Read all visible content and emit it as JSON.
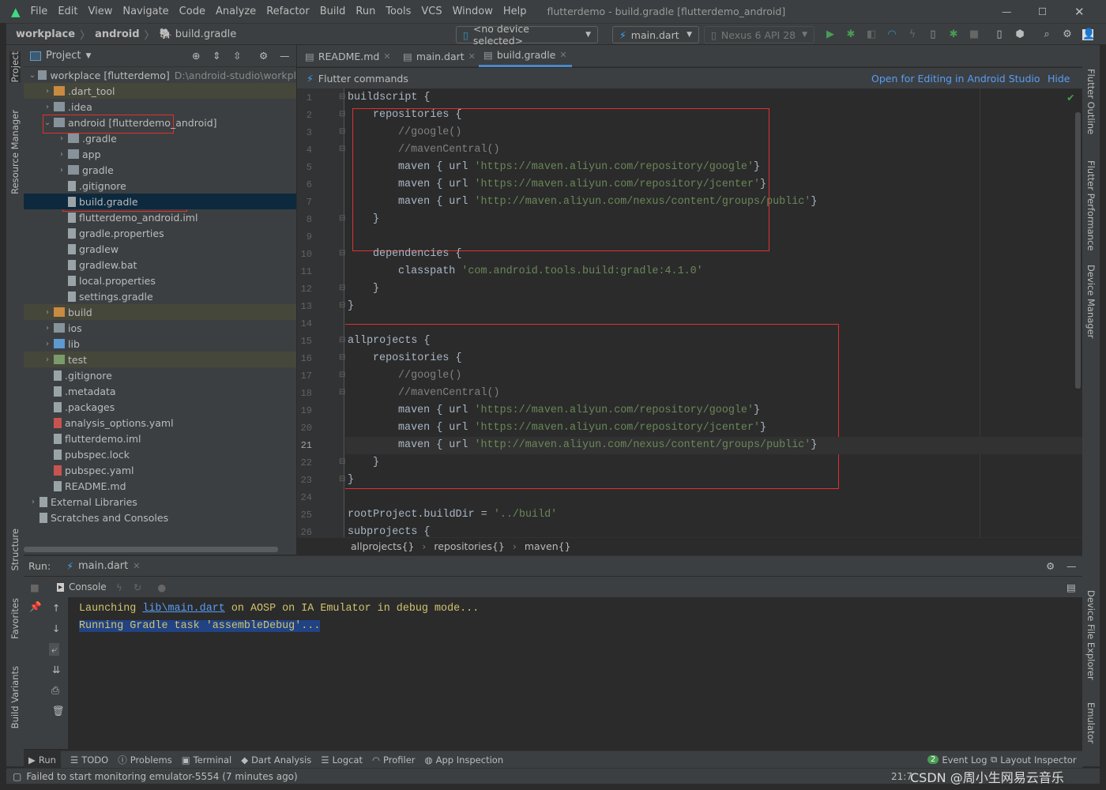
{
  "window": {
    "title": "flutterdemo - build.gradle [flutterdemo_android]"
  },
  "menu": [
    "File",
    "Edit",
    "View",
    "Navigate",
    "Code",
    "Analyze",
    "Refactor",
    "Build",
    "Run",
    "Tools",
    "VCS",
    "Window",
    "Help"
  ],
  "breadcrumb": [
    "workplace",
    "android",
    "build.gradle"
  ],
  "toolbar": {
    "device": "<no device selected>",
    "run_config": "main.dart",
    "avd": "Nexus 6 API 28"
  },
  "project": {
    "header": "Project",
    "tree": [
      {
        "label": "workplace [flutterdemo]",
        "extra": "D:\\android-studio\\workpl",
        "depth": 0,
        "open": true,
        "kind": "folder"
      },
      {
        "label": ".dart_tool",
        "depth": 1,
        "closed": true,
        "kind": "folder-orange",
        "hl": true
      },
      {
        "label": ".idea",
        "depth": 1,
        "closed": true,
        "kind": "folder"
      },
      {
        "label": "android [flutterdemo_android]",
        "depth": 1,
        "open": true,
        "kind": "folder"
      },
      {
        "label": ".gradle",
        "depth": 2,
        "closed": true,
        "kind": "folder"
      },
      {
        "label": "app",
        "depth": 2,
        "closed": true,
        "kind": "folder"
      },
      {
        "label": "gradle",
        "depth": 2,
        "closed": true,
        "kind": "folder"
      },
      {
        "label": ".gitignore",
        "depth": 2,
        "kind": "file"
      },
      {
        "label": "build.gradle",
        "depth": 2,
        "kind": "gradle",
        "sel": true
      },
      {
        "label": "flutterdemo_android.iml",
        "depth": 2,
        "kind": "file"
      },
      {
        "label": "gradle.properties",
        "depth": 2,
        "kind": "file"
      },
      {
        "label": "gradlew",
        "depth": 2,
        "kind": "file"
      },
      {
        "label": "gradlew.bat",
        "depth": 2,
        "kind": "file"
      },
      {
        "label": "local.properties",
        "depth": 2,
        "kind": "file"
      },
      {
        "label": "settings.gradle",
        "depth": 2,
        "kind": "gradle"
      },
      {
        "label": "build",
        "depth": 1,
        "closed": true,
        "kind": "folder-orange",
        "hl": true
      },
      {
        "label": "ios",
        "depth": 1,
        "closed": true,
        "kind": "folder"
      },
      {
        "label": "lib",
        "depth": 1,
        "closed": true,
        "kind": "folder-blue"
      },
      {
        "label": "test",
        "depth": 1,
        "closed": true,
        "kind": "folder-green",
        "hl": true
      },
      {
        "label": ".gitignore",
        "depth": 1,
        "kind": "file"
      },
      {
        "label": ".metadata",
        "depth": 1,
        "kind": "file"
      },
      {
        "label": ".packages",
        "depth": 1,
        "kind": "file"
      },
      {
        "label": "analysis_options.yaml",
        "depth": 1,
        "kind": "yaml"
      },
      {
        "label": "flutterdemo.iml",
        "depth": 1,
        "kind": "file"
      },
      {
        "label": "pubspec.lock",
        "depth": 1,
        "kind": "file"
      },
      {
        "label": "pubspec.yaml",
        "depth": 1,
        "kind": "yaml"
      },
      {
        "label": "README.md",
        "depth": 1,
        "kind": "file"
      },
      {
        "label": "External Libraries",
        "depth": 0,
        "closed": true,
        "kind": "lib"
      },
      {
        "label": "Scratches and Consoles",
        "depth": 0,
        "kind": "scratch"
      }
    ]
  },
  "editor": {
    "tabs": [
      "README.md",
      "main.dart",
      "build.gradle"
    ],
    "active_tab": 2,
    "flutter_bar": {
      "label": "Flutter commands",
      "open_link": "Open for Editing in Android Studio",
      "hide": "Hide"
    },
    "current_line": 21,
    "lines": [
      [
        [
          0,
          "buildscript {"
        ]
      ],
      [
        [
          1,
          "repositories {"
        ]
      ],
      [
        [
          2,
          "//google()",
          "cmt"
        ]
      ],
      [
        [
          2,
          "//mavenCentral()",
          "cmt"
        ]
      ],
      [
        [
          2,
          "maven { url "
        ],
        [
          "'https://maven.aliyun.com/repository/google'",
          "str"
        ],
        [
          "}"
        ]
      ],
      [
        [
          2,
          "maven { url "
        ],
        [
          "'https://maven.aliyun.com/repository/jcenter'",
          "str"
        ],
        [
          "}"
        ]
      ],
      [
        [
          2,
          "maven { url "
        ],
        [
          "'http://maven.aliyun.com/nexus/content/groups/public'",
          "str"
        ],
        [
          "}"
        ]
      ],
      [
        [
          1,
          "}"
        ]
      ],
      [
        [
          0,
          ""
        ]
      ],
      [
        [
          1,
          "dependencies {"
        ]
      ],
      [
        [
          2,
          "classpath "
        ],
        [
          "'com.android.tools.build:gradle:4.1.0'",
          "str"
        ]
      ],
      [
        [
          1,
          "}"
        ]
      ],
      [
        [
          0,
          "}"
        ]
      ],
      [
        [
          0,
          ""
        ]
      ],
      [
        [
          0,
          "allprojects {"
        ]
      ],
      [
        [
          1,
          "repositories {"
        ]
      ],
      [
        [
          2,
          "//google()",
          "cmt"
        ]
      ],
      [
        [
          2,
          "//mavenCentral()",
          "cmt"
        ]
      ],
      [
        [
          2,
          "maven { url "
        ],
        [
          "'https://maven.aliyun.com/repository/google'",
          "str"
        ],
        [
          "}"
        ]
      ],
      [
        [
          2,
          "maven { url "
        ],
        [
          "'https://maven.aliyun.com/repository/jcenter'",
          "str"
        ],
        [
          "}"
        ]
      ],
      [
        [
          2,
          "maven { url "
        ],
        [
          "'http://maven.aliyun.com/nexus/content/groups/public'",
          "str"
        ],
        [
          "}"
        ]
      ],
      [
        [
          1,
          "}"
        ]
      ],
      [
        [
          0,
          "}"
        ]
      ],
      [
        [
          0,
          ""
        ]
      ],
      [
        [
          0,
          "rootProject.buildDir = "
        ],
        [
          "'../build'",
          "str"
        ]
      ],
      [
        [
          0,
          "subprojects {"
        ]
      ]
    ],
    "structure_crumbs": [
      "allprojects{}",
      "repositories{}",
      "maven{}"
    ]
  },
  "run": {
    "label": "Run:",
    "config": "main.dart",
    "console_tab": "Console",
    "output": [
      {
        "pre": "Launching ",
        "link": "lib\\main.dart",
        "post": " on AOSP on IA Emulator in debug mode..."
      },
      {
        "sel": "Running Gradle task 'assembleDebug'..."
      }
    ]
  },
  "bottom_tools": [
    "Run",
    "TODO",
    "Problems",
    "Terminal",
    "Dart Analysis",
    "Logcat",
    "Profiler",
    "App Inspection"
  ],
  "bottom_right": {
    "event_log": "Event Log",
    "event_count": "2",
    "layout_inspector": "Layout Inspector"
  },
  "left_tools": [
    "Project",
    "Resource Manager",
    "Structure",
    "Favorites",
    "Build Variants"
  ],
  "right_tools": [
    "Flutter Outline",
    "Flutter Performance",
    "Device Manager",
    "Device File Explorer",
    "Emulator"
  ],
  "status": {
    "message": "Failed to start monitoring emulator-5554 (7 minutes ago)",
    "time": "21:7",
    "watermark": "CSDN @周小生网易云音乐"
  },
  "colors": {
    "accent": "#4a88c7",
    "highlight_box": "#e03030",
    "string": "#6a8759",
    "comment": "#808080"
  }
}
